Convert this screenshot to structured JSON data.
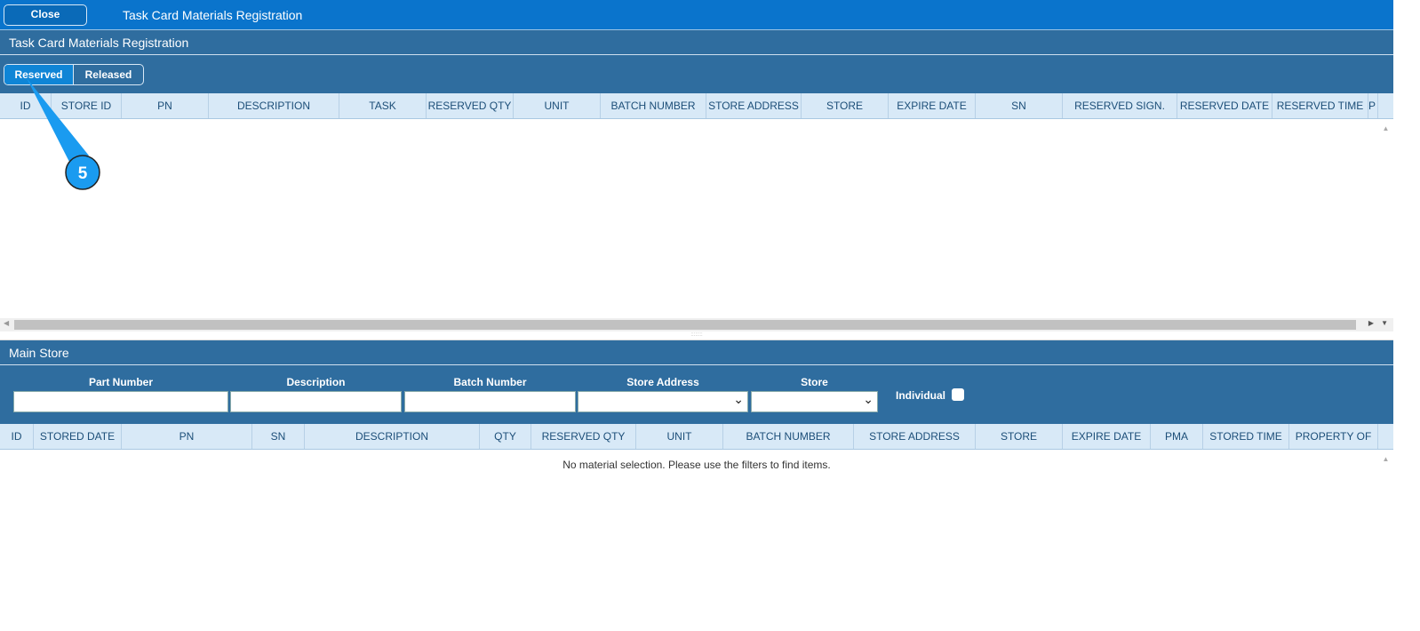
{
  "topbar": {
    "close_label": "Close",
    "title": "Task Card Materials Registration"
  },
  "panel": {
    "title": "Task Card Materials Registration"
  },
  "tabs": {
    "reserved": "Reserved",
    "released": "Released"
  },
  "reserved_table": {
    "columns": [
      "ID",
      "STORE ID",
      "PN",
      "DESCRIPTION",
      "TASK",
      "RESERVED QTY",
      "UNIT",
      "BATCH NUMBER",
      "STORE ADDRESS",
      "STORE",
      "EXPIRE DATE",
      "SN",
      "RESERVED SIGN.",
      "RESERVED DATE",
      "RESERVED TIME",
      "P"
    ]
  },
  "main_store": {
    "title": "Main Store",
    "filters": {
      "part_number": "Part Number",
      "description": "Description",
      "batch_number": "Batch Number",
      "store_address": "Store Address",
      "store": "Store",
      "individual": "Individual"
    },
    "columns": [
      "ID",
      "STORED DATE",
      "PN",
      "SN",
      "DESCRIPTION",
      "QTY",
      "RESERVED QTY",
      "UNIT",
      "BATCH NUMBER",
      "STORE ADDRESS",
      "STORE",
      "EXPIRE DATE",
      "PMA",
      "STORED TIME",
      "PROPERTY OF"
    ],
    "empty_message": "No material selection. Please use the filters to find items."
  },
  "annotation": {
    "step": "5"
  }
}
